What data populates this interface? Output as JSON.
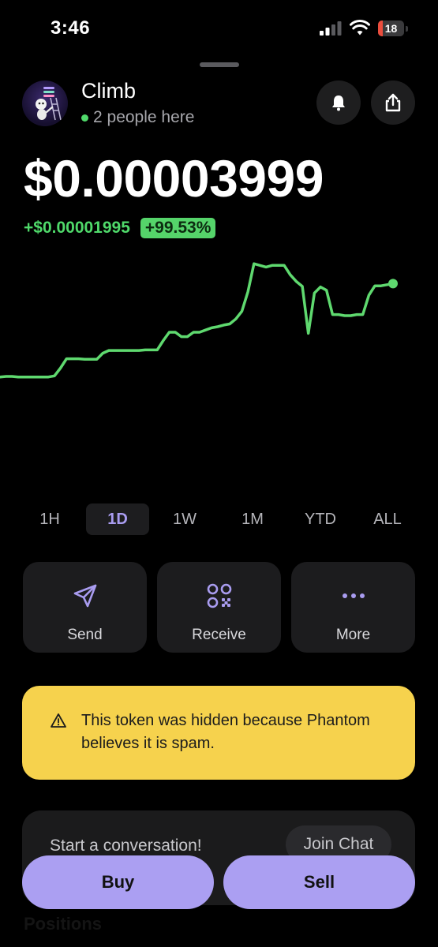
{
  "status_bar": {
    "time": "3:46",
    "battery_level": "18",
    "battery_fill_fraction": 0.18,
    "battery_color": "#eb4d3d"
  },
  "token": {
    "name": "Climb",
    "people_here": "2 people here",
    "price": "$0.00003999",
    "change_abs": "+$0.00001995",
    "change_pct": "+99.53%"
  },
  "header_icons": [
    "bell-icon",
    "share-icon"
  ],
  "chart_data": {
    "type": "line",
    "color": "#5fd96f",
    "title": "",
    "xlabel": "",
    "ylabel": "",
    "ylim": [
      0,
      4e-05
    ],
    "x_range": "1D",
    "values": [
      1.99e-05,
      2e-05,
      2e-05,
      1.99e-05,
      1.99e-05,
      1.99e-05,
      1.99e-05,
      1.99e-05,
      1.99e-05,
      2.01e-05,
      2.15e-05,
      2.32e-05,
      2.32e-05,
      2.32e-05,
      2.31e-05,
      2.31e-05,
      2.31e-05,
      2.42e-05,
      2.47e-05,
      2.47e-05,
      2.47e-05,
      2.47e-05,
      2.47e-05,
      2.47e-05,
      2.48e-05,
      2.48e-05,
      2.48e-05,
      2.65e-05,
      2.8e-05,
      2.8e-05,
      2.72e-05,
      2.72e-05,
      2.8e-05,
      2.8e-05,
      2.84e-05,
      2.88e-05,
      2.9e-05,
      2.93e-05,
      2.95e-05,
      3.04e-05,
      3.18e-05,
      3.53e-05,
      4.04e-05,
      4.01e-05,
      3.98e-05,
      4.01e-05,
      4.01e-05,
      4.01e-05,
      3.84e-05,
      3.72e-05,
      3.63e-05,
      2.78e-05,
      3.51e-05,
      3.62e-05,
      3.56e-05,
      3.12e-05,
      3.12e-05,
      3.1e-05,
      3.1e-05,
      3.12e-05,
      3.12e-05,
      3.47e-05,
      3.64e-05,
      3.64e-05,
      3.66e-05,
      3.68e-05
    ],
    "last_point_marker": true
  },
  "range_tabs": [
    {
      "label": "1H",
      "active": false
    },
    {
      "label": "1D",
      "active": true
    },
    {
      "label": "1W",
      "active": false
    },
    {
      "label": "1M",
      "active": false
    },
    {
      "label": "YTD",
      "active": false
    },
    {
      "label": "ALL",
      "active": false
    }
  ],
  "actions": [
    {
      "label": "Send",
      "icon": "send-icon"
    },
    {
      "label": "Receive",
      "icon": "qr-code-icon"
    },
    {
      "label": "More",
      "icon": "more-dots-icon"
    }
  ],
  "warning": {
    "icon": "warning-triangle-icon",
    "text": "This token was hidden because Phantom believes it is spam.",
    "background": "#f6d24d"
  },
  "chat": {
    "prompt": "Start a conversation!",
    "join_label": "Join Chat"
  },
  "positions_label": "Positions",
  "buttons": {
    "buy": "Buy",
    "sell": "Sell",
    "accent": "#ab9ff2"
  },
  "colors": {
    "positive": "#4fd96a",
    "accent_text": "#a99cf0"
  }
}
